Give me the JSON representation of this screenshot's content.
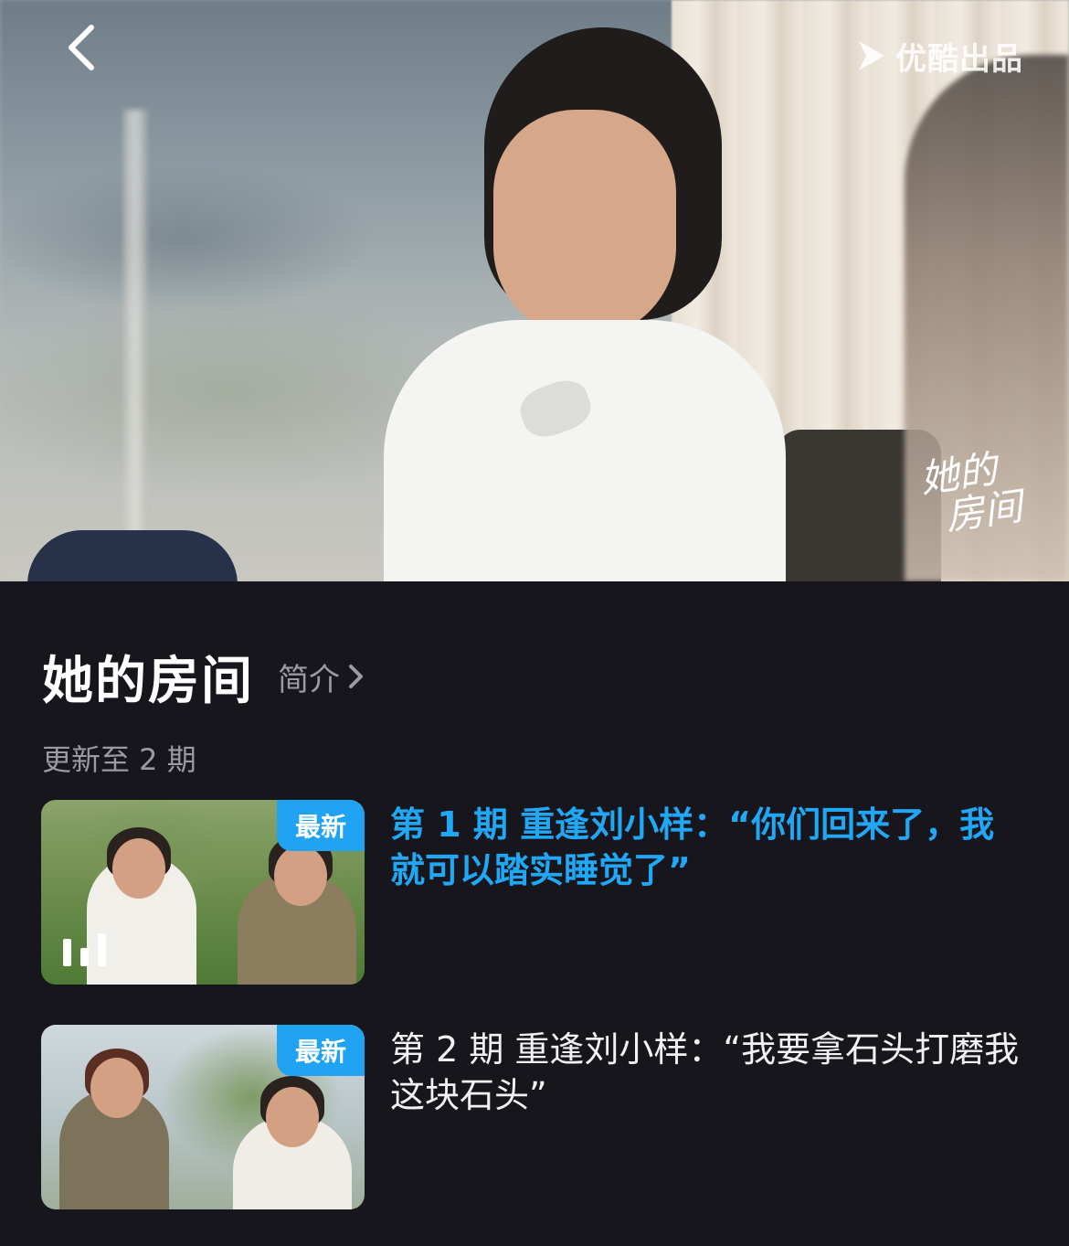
{
  "player": {
    "brand_label": "优酷出品",
    "watermark_line1": "她的",
    "watermark_line2": "房间"
  },
  "show": {
    "title": "她的房间",
    "intro_label": "简介",
    "update_status": "更新至 2 期"
  },
  "episodes": [
    {
      "title": "第 1 期  重逢刘小样：“你们回来了，我就可以踏实睡觉了”",
      "tag": "最新",
      "playing": true,
      "active_color": "#20a7f5"
    },
    {
      "title": "第 2 期  重逢刘小样：“我要拿石头打磨我这块石头”",
      "tag": "最新",
      "playing": false
    }
  ],
  "colors": {
    "background": "#16161c",
    "accent": "#1fa3f2",
    "secondary_text": "#9a9aa2"
  }
}
